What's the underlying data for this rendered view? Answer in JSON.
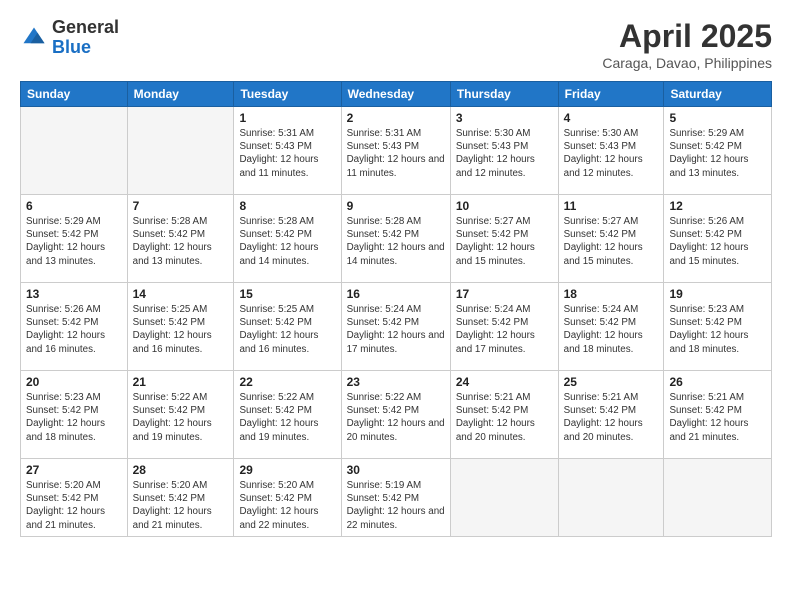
{
  "header": {
    "logo_general": "General",
    "logo_blue": "Blue",
    "title": "April 2025",
    "location": "Caraga, Davao, Philippines"
  },
  "weekdays": [
    "Sunday",
    "Monday",
    "Tuesday",
    "Wednesday",
    "Thursday",
    "Friday",
    "Saturday"
  ],
  "weeks": [
    [
      {
        "day": "",
        "info": ""
      },
      {
        "day": "",
        "info": ""
      },
      {
        "day": "1",
        "info": "Sunrise: 5:31 AM\nSunset: 5:43 PM\nDaylight: 12 hours and 11 minutes."
      },
      {
        "day": "2",
        "info": "Sunrise: 5:31 AM\nSunset: 5:43 PM\nDaylight: 12 hours and 11 minutes."
      },
      {
        "day": "3",
        "info": "Sunrise: 5:30 AM\nSunset: 5:43 PM\nDaylight: 12 hours and 12 minutes."
      },
      {
        "day": "4",
        "info": "Sunrise: 5:30 AM\nSunset: 5:43 PM\nDaylight: 12 hours and 12 minutes."
      },
      {
        "day": "5",
        "info": "Sunrise: 5:29 AM\nSunset: 5:42 PM\nDaylight: 12 hours and 13 minutes."
      }
    ],
    [
      {
        "day": "6",
        "info": "Sunrise: 5:29 AM\nSunset: 5:42 PM\nDaylight: 12 hours and 13 minutes."
      },
      {
        "day": "7",
        "info": "Sunrise: 5:28 AM\nSunset: 5:42 PM\nDaylight: 12 hours and 13 minutes."
      },
      {
        "day": "8",
        "info": "Sunrise: 5:28 AM\nSunset: 5:42 PM\nDaylight: 12 hours and 14 minutes."
      },
      {
        "day": "9",
        "info": "Sunrise: 5:28 AM\nSunset: 5:42 PM\nDaylight: 12 hours and 14 minutes."
      },
      {
        "day": "10",
        "info": "Sunrise: 5:27 AM\nSunset: 5:42 PM\nDaylight: 12 hours and 15 minutes."
      },
      {
        "day": "11",
        "info": "Sunrise: 5:27 AM\nSunset: 5:42 PM\nDaylight: 12 hours and 15 minutes."
      },
      {
        "day": "12",
        "info": "Sunrise: 5:26 AM\nSunset: 5:42 PM\nDaylight: 12 hours and 15 minutes."
      }
    ],
    [
      {
        "day": "13",
        "info": "Sunrise: 5:26 AM\nSunset: 5:42 PM\nDaylight: 12 hours and 16 minutes."
      },
      {
        "day": "14",
        "info": "Sunrise: 5:25 AM\nSunset: 5:42 PM\nDaylight: 12 hours and 16 minutes."
      },
      {
        "day": "15",
        "info": "Sunrise: 5:25 AM\nSunset: 5:42 PM\nDaylight: 12 hours and 16 minutes."
      },
      {
        "day": "16",
        "info": "Sunrise: 5:24 AM\nSunset: 5:42 PM\nDaylight: 12 hours and 17 minutes."
      },
      {
        "day": "17",
        "info": "Sunrise: 5:24 AM\nSunset: 5:42 PM\nDaylight: 12 hours and 17 minutes."
      },
      {
        "day": "18",
        "info": "Sunrise: 5:24 AM\nSunset: 5:42 PM\nDaylight: 12 hours and 18 minutes."
      },
      {
        "day": "19",
        "info": "Sunrise: 5:23 AM\nSunset: 5:42 PM\nDaylight: 12 hours and 18 minutes."
      }
    ],
    [
      {
        "day": "20",
        "info": "Sunrise: 5:23 AM\nSunset: 5:42 PM\nDaylight: 12 hours and 18 minutes."
      },
      {
        "day": "21",
        "info": "Sunrise: 5:22 AM\nSunset: 5:42 PM\nDaylight: 12 hours and 19 minutes."
      },
      {
        "day": "22",
        "info": "Sunrise: 5:22 AM\nSunset: 5:42 PM\nDaylight: 12 hours and 19 minutes."
      },
      {
        "day": "23",
        "info": "Sunrise: 5:22 AM\nSunset: 5:42 PM\nDaylight: 12 hours and 20 minutes."
      },
      {
        "day": "24",
        "info": "Sunrise: 5:21 AM\nSunset: 5:42 PM\nDaylight: 12 hours and 20 minutes."
      },
      {
        "day": "25",
        "info": "Sunrise: 5:21 AM\nSunset: 5:42 PM\nDaylight: 12 hours and 20 minutes."
      },
      {
        "day": "26",
        "info": "Sunrise: 5:21 AM\nSunset: 5:42 PM\nDaylight: 12 hours and 21 minutes."
      }
    ],
    [
      {
        "day": "27",
        "info": "Sunrise: 5:20 AM\nSunset: 5:42 PM\nDaylight: 12 hours and 21 minutes."
      },
      {
        "day": "28",
        "info": "Sunrise: 5:20 AM\nSunset: 5:42 PM\nDaylight: 12 hours and 21 minutes."
      },
      {
        "day": "29",
        "info": "Sunrise: 5:20 AM\nSunset: 5:42 PM\nDaylight: 12 hours and 22 minutes."
      },
      {
        "day": "30",
        "info": "Sunrise: 5:19 AM\nSunset: 5:42 PM\nDaylight: 12 hours and 22 minutes."
      },
      {
        "day": "",
        "info": ""
      },
      {
        "day": "",
        "info": ""
      },
      {
        "day": "",
        "info": ""
      }
    ]
  ]
}
